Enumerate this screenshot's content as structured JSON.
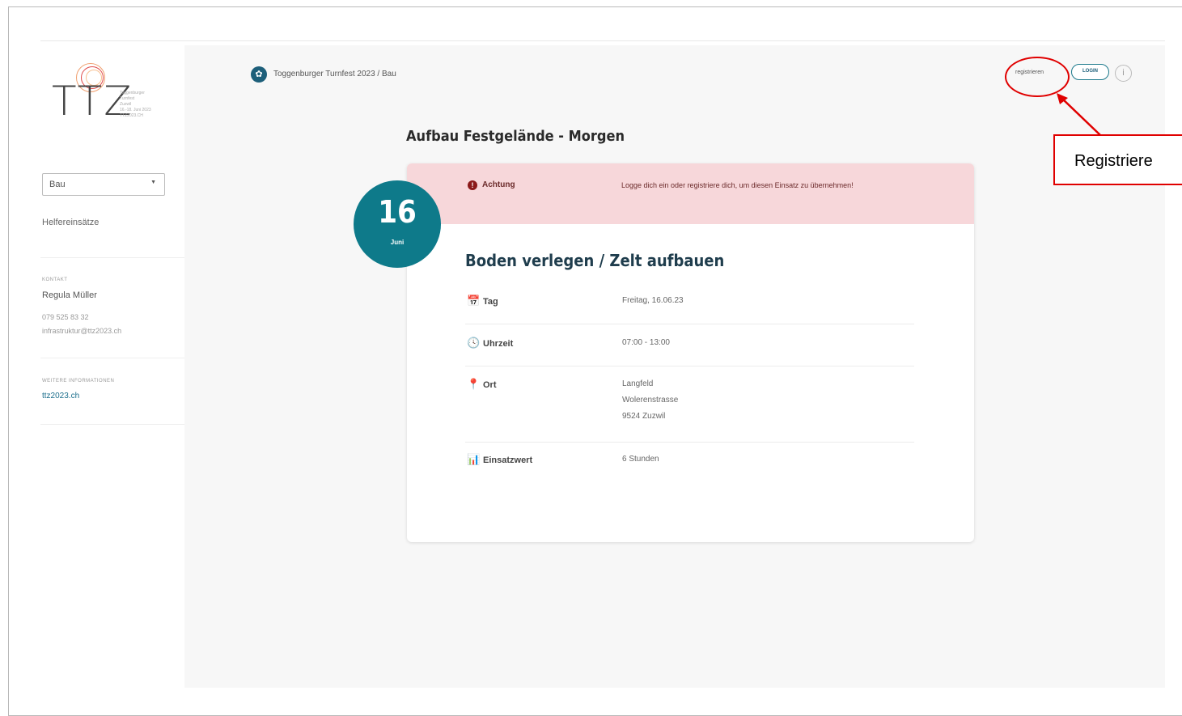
{
  "sidebar": {
    "logo_letters": "TTZ",
    "logo_meta": [
      "Toggenburger",
      "Turnfest",
      "Zuzwil",
      "16.-18. Juni 2023",
      "TTZ2023.CH"
    ],
    "select_value": "Bau",
    "nav_item": "Helfereinsätze",
    "contact_heading": "Kontakt",
    "contact_name": "Regula Müller",
    "contact_phone": "079 525 83 32",
    "contact_email": "infrastruktur@ttz2023.ch",
    "info_heading": "Weitere Informationen",
    "info_link": "ttz2023.ch"
  },
  "header": {
    "breadcrumb": "Toggenburger Turnfest 2023 / Bau",
    "register_link": "registrieren",
    "login_button": "LOGIN",
    "info_symbol": "i"
  },
  "page": {
    "title": "Aufbau Festgelände - Morgen"
  },
  "date_badge": {
    "day": "16",
    "month": "Juni"
  },
  "alert": {
    "label": "Achtung",
    "message": "Logge dich ein oder registriere dich, um diesen Einsatz zu übernehmen!"
  },
  "job": {
    "title": "Boden verlegen / Zelt aufbauen",
    "rows": [
      {
        "icon": "calendar-icon",
        "label": "Tag",
        "value": "Freitag, 16.06.23"
      },
      {
        "icon": "clock-icon",
        "label": "Uhrzeit",
        "value": "07:00 - 13:00"
      },
      {
        "icon": "location-pin-icon",
        "label": "Ort",
        "value_lines": [
          "Langfeld",
          "Wolerenstrasse",
          "9524 Zuzwil"
        ]
      },
      {
        "icon": "bar-chart-icon",
        "label": "Einsatzwert",
        "value": "6 Stunden"
      }
    ]
  },
  "annotation": {
    "callout_text": "Registriere",
    "color": "#e00000"
  },
  "colors": {
    "accent": "#0e7a8a",
    "alert_bg": "#f7d7da",
    "link": "#1b6e8c"
  }
}
